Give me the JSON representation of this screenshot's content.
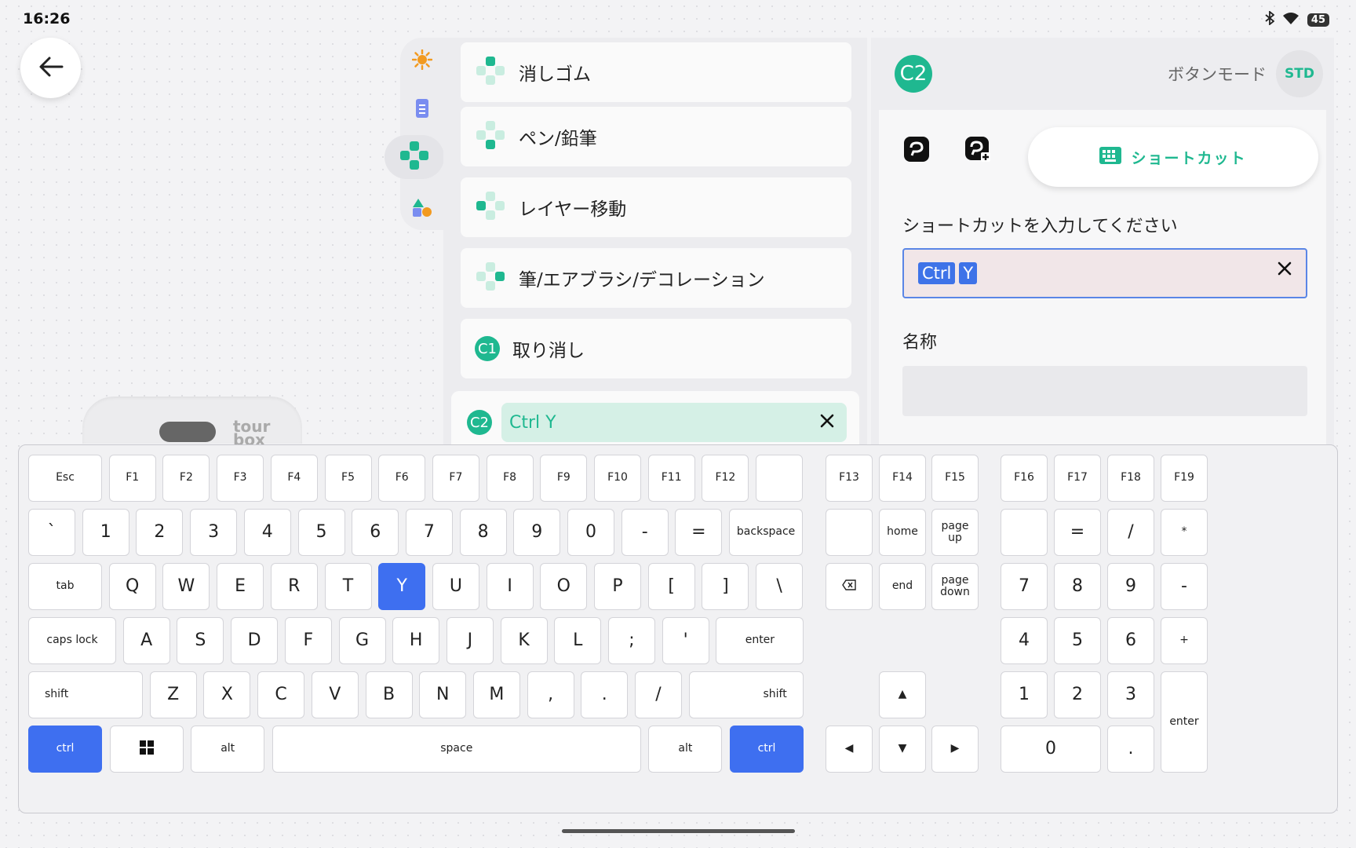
{
  "status": {
    "time": "16:26",
    "battery": "45"
  },
  "device": {
    "brand": "tour\nbox"
  },
  "actions": [
    {
      "label": "消しゴム"
    },
    {
      "label": "ペン/鉛筆"
    },
    {
      "label": "レイヤー移動"
    },
    {
      "label": "筆/エアブラシ/デコレーション"
    },
    {
      "label": "取り消し",
      "badge": "C1"
    }
  ],
  "active_action": {
    "badge": "C2",
    "value": "Ctrl Y"
  },
  "right_panel": {
    "button_id": "C2",
    "mode_label": "ボタンモード",
    "mode_badge": "STD",
    "tab_shortcut_label": "ショートカット",
    "prompt": "ショートカットを入力してください",
    "shortcut_keys": [
      "Ctrl",
      "Y"
    ],
    "name_label": "名称",
    "name_value": ""
  },
  "colors": {
    "accent": "#1fb890",
    "key_active": "#3e6ff0"
  },
  "keyboard": {
    "rows": [
      [
        "Esc",
        "F1",
        "F2",
        "F3",
        "F4",
        "F5",
        "F6",
        "F7",
        "F8",
        "F9",
        "F10",
        "F11",
        "F12",
        ""
      ],
      [
        "`",
        "1",
        "2",
        "3",
        "4",
        "5",
        "6",
        "7",
        "8",
        "9",
        "0",
        "-",
        "=",
        "backspace"
      ],
      [
        "tab",
        "Q",
        "W",
        "E",
        "R",
        "T",
        "Y",
        "U",
        "I",
        "O",
        "P",
        "[",
        "]",
        "\\"
      ],
      [
        "caps lock",
        "A",
        "S",
        "D",
        "F",
        "G",
        "H",
        "J",
        "K",
        "L",
        ";",
        "'",
        "enter"
      ],
      [
        "shift",
        "Z",
        "X",
        "C",
        "V",
        "B",
        "N",
        "M",
        ",",
        ".",
        "/",
        "shift"
      ],
      [
        "ctrl",
        "win-icon",
        "alt",
        "space",
        "alt",
        "ctrl"
      ]
    ],
    "nav": {
      "r0": [
        "F13",
        "F14",
        "F15"
      ],
      "r1": [
        "",
        "home",
        "page\nup"
      ],
      "r2": [
        "delete-icon",
        "end",
        "page\ndown"
      ],
      "arrows": [
        "▲",
        "◀",
        "▼",
        "▶"
      ]
    },
    "numpad": {
      "r0": [
        "F16",
        "F17",
        "F18",
        "F19"
      ],
      "r1": [
        "",
        "=",
        "/",
        "*"
      ],
      "r2": [
        "7",
        "8",
        "9",
        "-"
      ],
      "r3": [
        "4",
        "5",
        "6",
        "+"
      ],
      "r4": [
        "1",
        "2",
        "3"
      ],
      "r5": [
        "0",
        "."
      ],
      "enter": "enter"
    },
    "active_keys": [
      "ctrl",
      "Y"
    ]
  }
}
